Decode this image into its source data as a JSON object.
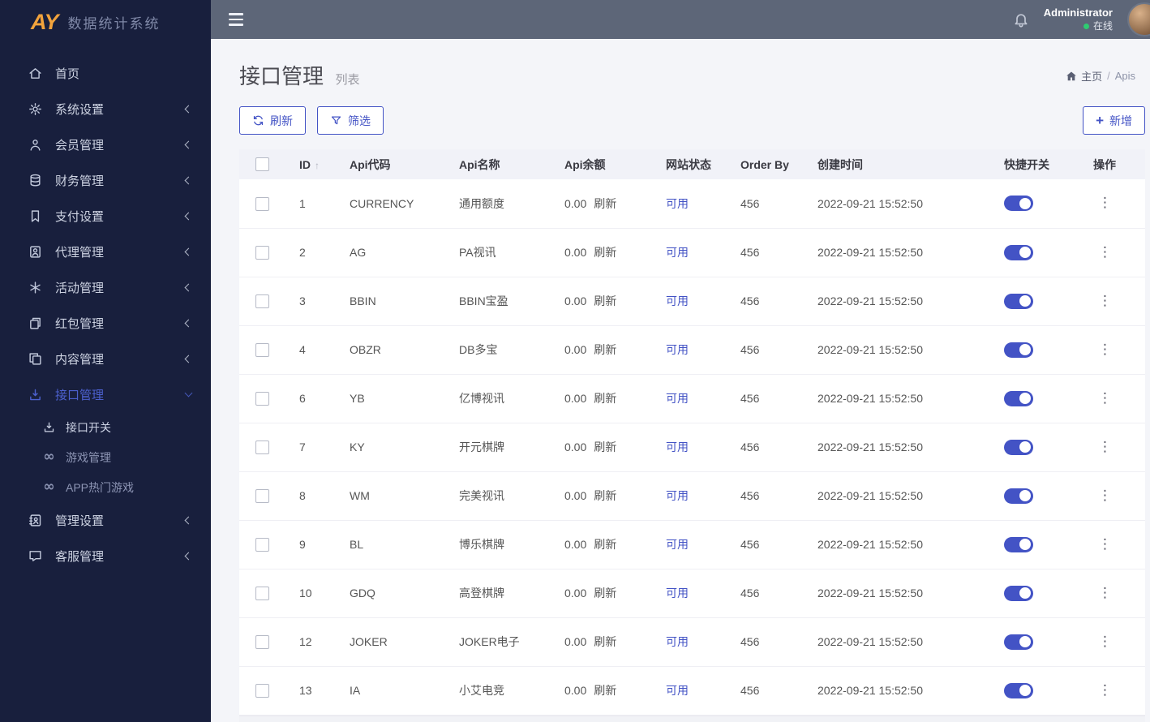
{
  "brand": {
    "logo": "AY",
    "title": "数据统计系统"
  },
  "topbar": {
    "user": {
      "name": "Administrator",
      "status": "在线"
    }
  },
  "sidebar": {
    "items": [
      {
        "label": "首页",
        "icon": "home-icon",
        "chevron": false
      },
      {
        "label": "系统设置",
        "icon": "settings-icon",
        "chevron": true
      },
      {
        "label": "会员管理",
        "icon": "member-icon",
        "chevron": true
      },
      {
        "label": "财务管理",
        "icon": "finance-icon",
        "chevron": true
      },
      {
        "label": "支付设置",
        "icon": "payment-icon",
        "chevron": true
      },
      {
        "label": "代理管理",
        "icon": "agent-icon",
        "chevron": true
      },
      {
        "label": "活动管理",
        "icon": "activity-icon",
        "chevron": true
      },
      {
        "label": "红包管理",
        "icon": "redpacket-icon",
        "chevron": true
      },
      {
        "label": "内容管理",
        "icon": "content-icon",
        "chevron": true
      },
      {
        "label": "接口管理",
        "icon": "api-icon",
        "chevron": true,
        "active": true,
        "expanded": true,
        "children": [
          {
            "label": "接口开关",
            "icon": "api-switch-icon",
            "active": true
          },
          {
            "label": "游戏管理",
            "icon": "game-icon",
            "active": false
          },
          {
            "label": "APP热门游戏",
            "icon": "hot-game-icon",
            "active": false
          }
        ]
      },
      {
        "label": "管理设置",
        "icon": "admin-icon",
        "chevron": true
      },
      {
        "label": "客服管理",
        "icon": "service-icon",
        "chevron": true
      }
    ]
  },
  "page": {
    "title": "接口管理",
    "subtitle": "列表",
    "breadcrumb_home": "主页",
    "breadcrumb_sep": "/",
    "breadcrumb_current": "Apis"
  },
  "toolbar": {
    "refresh": "刷新",
    "filter": "筛选",
    "add": "新增"
  },
  "table": {
    "headers": {
      "id": "ID",
      "code": "Api代码",
      "name": "Api名称",
      "balance": "Api余额",
      "status": "网站状态",
      "order": "Order By",
      "created": "创建时间",
      "switch": "快捷开关",
      "actions": "操作"
    },
    "labels": {
      "refresh": "刷新",
      "status": "可用"
    },
    "rows": [
      {
        "id": "1",
        "code": "CURRENCY",
        "name": "通用额度",
        "balance": "0.00",
        "order": "456",
        "created": "2022-09-21 15:52:50",
        "switch_on": true
      },
      {
        "id": "2",
        "code": "AG",
        "name": "PA视讯",
        "balance": "0.00",
        "order": "456",
        "created": "2022-09-21 15:52:50",
        "switch_on": true
      },
      {
        "id": "3",
        "code": "BBIN",
        "name": "BBIN宝盈",
        "balance": "0.00",
        "order": "456",
        "created": "2022-09-21 15:52:50",
        "switch_on": true
      },
      {
        "id": "4",
        "code": "OBZR",
        "name": "DB多宝",
        "balance": "0.00",
        "order": "456",
        "created": "2022-09-21 15:52:50",
        "switch_on": true
      },
      {
        "id": "6",
        "code": "YB",
        "name": "亿博视讯",
        "balance": "0.00",
        "order": "456",
        "created": "2022-09-21 15:52:50",
        "switch_on": true
      },
      {
        "id": "7",
        "code": "KY",
        "name": "开元棋牌",
        "balance": "0.00",
        "order": "456",
        "created": "2022-09-21 15:52:50",
        "switch_on": true
      },
      {
        "id": "8",
        "code": "WM",
        "name": "完美视讯",
        "balance": "0.00",
        "order": "456",
        "created": "2022-09-21 15:52:50",
        "switch_on": true
      },
      {
        "id": "9",
        "code": "BL",
        "name": "博乐棋牌",
        "balance": "0.00",
        "order": "456",
        "created": "2022-09-21 15:52:50",
        "switch_on": true
      },
      {
        "id": "10",
        "code": "GDQ",
        "name": "高登棋牌",
        "balance": "0.00",
        "order": "456",
        "created": "2022-09-21 15:52:50",
        "switch_on": true
      },
      {
        "id": "12",
        "code": "JOKER",
        "name": "JOKER电子",
        "balance": "0.00",
        "order": "456",
        "created": "2022-09-21 15:52:50",
        "switch_on": true
      },
      {
        "id": "13",
        "code": "IA",
        "name": "小艾电竞",
        "balance": "0.00",
        "order": "456",
        "created": "2022-09-21 15:52:50",
        "switch_on": true
      }
    ]
  },
  "icons": [
    "menu-icon",
    "bell-icon",
    "home-icon",
    "settings-icon",
    "member-icon",
    "finance-icon",
    "payment-icon",
    "agent-icon",
    "activity-icon",
    "redpacket-icon",
    "content-icon",
    "api-icon",
    "api-switch-icon",
    "game-icon",
    "hot-game-icon",
    "admin-icon",
    "service-icon",
    "refresh-icon",
    "filter-icon",
    "plus-icon",
    "sort-asc-icon",
    "row-actions-icon",
    "chevron-left-icon",
    "chevron-down-icon",
    "online-dot"
  ],
  "colors": {
    "accent": "#4353c5",
    "sidebar_bg": "#181f3d",
    "topbar_bg": "#5d6678",
    "brand_orange": "#f2a33c",
    "online_green": "#2ecc71",
    "table_header_bg": "#f1f2f8"
  }
}
